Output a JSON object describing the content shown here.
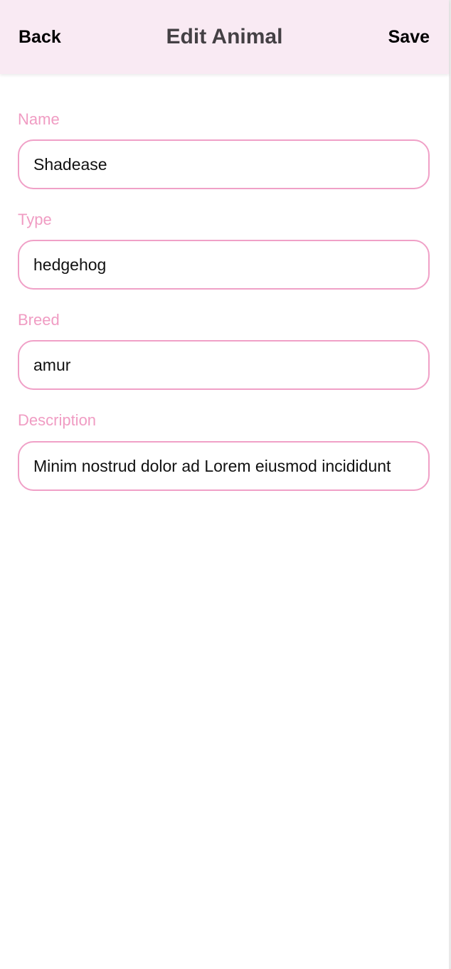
{
  "header": {
    "back_label": "Back",
    "title": "Edit Animal",
    "save_label": "Save"
  },
  "form": {
    "name": {
      "label": "Name",
      "value": "Shadease"
    },
    "type": {
      "label": "Type",
      "value": "hedgehog"
    },
    "breed": {
      "label": "Breed",
      "value": "amur"
    },
    "description": {
      "label": "Description",
      "value": "Minim nostrud dolor ad Lorem eiusmod incididunt"
    }
  },
  "colors": {
    "header_bg": "#f9eaf3",
    "accent": "#f09cc3",
    "title": "#444044"
  }
}
